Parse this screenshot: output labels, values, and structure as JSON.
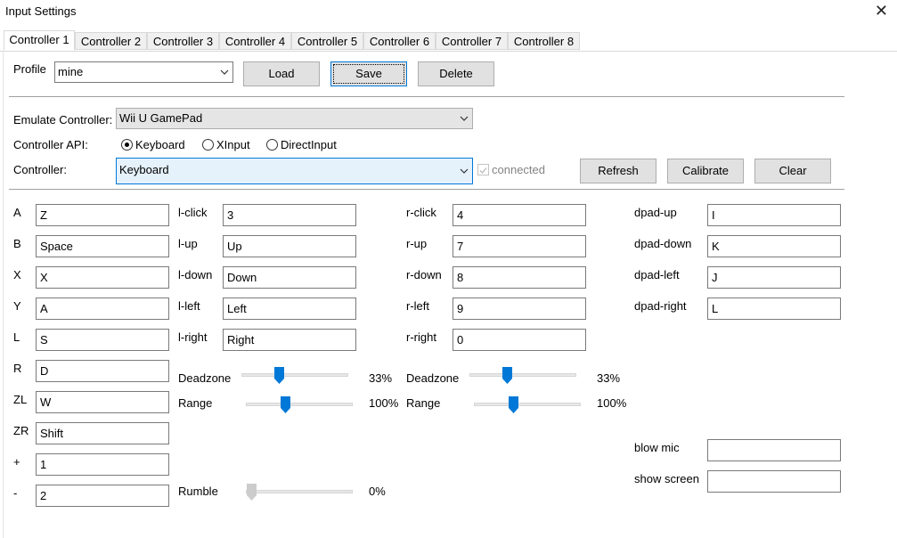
{
  "window": {
    "title": "Input Settings",
    "close_glyph": "✕"
  },
  "tabs": [
    "Controller 1",
    "Controller 2",
    "Controller 3",
    "Controller 4",
    "Controller 5",
    "Controller 6",
    "Controller 7",
    "Controller 8"
  ],
  "profile": {
    "label": "Profile",
    "value": "mine",
    "load": "Load",
    "save": "Save",
    "delete": "Delete"
  },
  "emulate": {
    "label": "Emulate Controller:",
    "value": "Wii U GamePad"
  },
  "api": {
    "label": "Controller API:",
    "options": [
      "Keyboard",
      "XInput",
      "DirectInput"
    ],
    "selected": "Keyboard"
  },
  "controller": {
    "label": "Controller:",
    "value": "Keyboard",
    "connected_label": "connected",
    "refresh": "Refresh",
    "calibrate": "Calibrate",
    "clear": "Clear"
  },
  "buttons": [
    {
      "label": "A",
      "value": "Z"
    },
    {
      "label": "B",
      "value": "Space"
    },
    {
      "label": "X",
      "value": "X"
    },
    {
      "label": "Y",
      "value": "A"
    },
    {
      "label": "L",
      "value": "S"
    },
    {
      "label": "R",
      "value": "D"
    },
    {
      "label": "ZL",
      "value": "W"
    },
    {
      "label": "ZR",
      "value": "Shift"
    },
    {
      "label": "+",
      "value": "1"
    },
    {
      "label": "-",
      "value": "2"
    }
  ],
  "left_stick": [
    {
      "label": "l-click",
      "value": "3"
    },
    {
      "label": "l-up",
      "value": "Up"
    },
    {
      "label": "l-down",
      "value": "Down"
    },
    {
      "label": "l-left",
      "value": "Left"
    },
    {
      "label": "l-right",
      "value": "Right"
    }
  ],
  "right_stick": [
    {
      "label": "r-click",
      "value": "4"
    },
    {
      "label": "r-up",
      "value": "7"
    },
    {
      "label": "r-down",
      "value": "8"
    },
    {
      "label": "r-left",
      "value": "9"
    },
    {
      "label": "r-right",
      "value": "0"
    }
  ],
  "dpad": [
    {
      "label": "dpad-up",
      "value": "I"
    },
    {
      "label": "dpad-down",
      "value": "K"
    },
    {
      "label": "dpad-left",
      "value": "J"
    },
    {
      "label": "dpad-right",
      "value": "L"
    }
  ],
  "left_sliders": {
    "deadzone": {
      "label": "Deadzone",
      "percent_text": "33%",
      "value": 0.33
    },
    "range": {
      "label": "Range",
      "percent_text": "100%",
      "value": 0.35
    }
  },
  "right_sliders": {
    "deadzone": {
      "label": "Deadzone",
      "percent_text": "33%",
      "value": 0.33
    },
    "range": {
      "label": "Range",
      "percent_text": "100%",
      "value": 0.35
    }
  },
  "rumble": {
    "label": "Rumble",
    "percent_text": "0%",
    "value": 0.0
  },
  "extras": [
    {
      "label": "blow mic",
      "value": ""
    },
    {
      "label": "show screen",
      "value": ""
    }
  ],
  "colors": {
    "accent": "#0078d7",
    "button_bg": "#e1e1e1",
    "separator": "#a0a0a0"
  }
}
